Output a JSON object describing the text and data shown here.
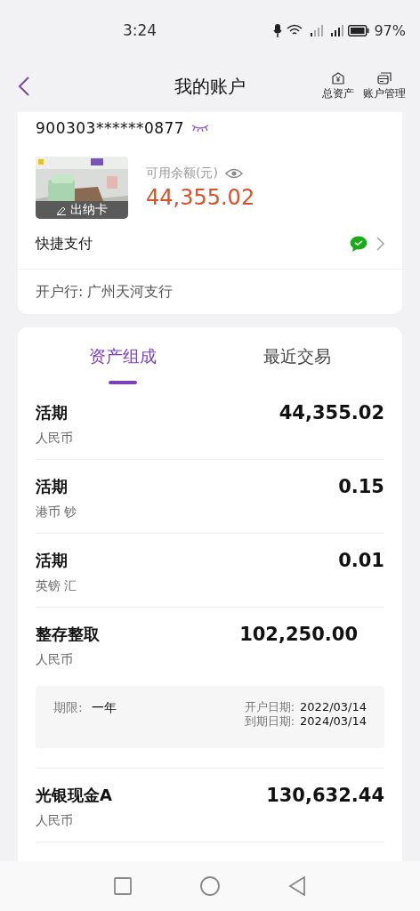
{
  "status_bar": {
    "time": "3:24",
    "battery": "97%"
  },
  "header": {
    "title": "我的账户",
    "actions": [
      {
        "label": "总资产",
        "kind": "assets"
      },
      {
        "label": "账户管理",
        "kind": "manage"
      }
    ]
  },
  "account": {
    "number": "900303******0877",
    "card_label": "出纳卡",
    "balance_label": "可用余额(元)",
    "balance": "44,355.02",
    "quick_pay": "快捷支付",
    "branch": "开户行:  广州天河支行"
  },
  "tabs": [
    {
      "label": "资产组成",
      "selected": true
    },
    {
      "label": "最近交易",
      "selected": false
    }
  ],
  "assets": [
    {
      "kind": "simple",
      "name": "活期",
      "currency": "人民币",
      "amount": "44,355.02"
    },
    {
      "kind": "simple",
      "name": "活期",
      "currency": "港币 钞",
      "amount": "0.15"
    },
    {
      "kind": "simple",
      "name": "活期",
      "currency": "英镑 汇",
      "amount": "0.01"
    },
    {
      "kind": "term",
      "name": "整存整取",
      "currency": "人民币",
      "amount": "102,250.00",
      "term_label": "期限:",
      "term": "一年",
      "open_label": "开户日期:",
      "open_date": "2022/03/14",
      "due_label": "到期日期:",
      "due_date": "2024/03/14"
    },
    {
      "kind": "simple",
      "name": "光银现金A",
      "currency": "人民币",
      "amount": "130,632.44"
    }
  ]
}
